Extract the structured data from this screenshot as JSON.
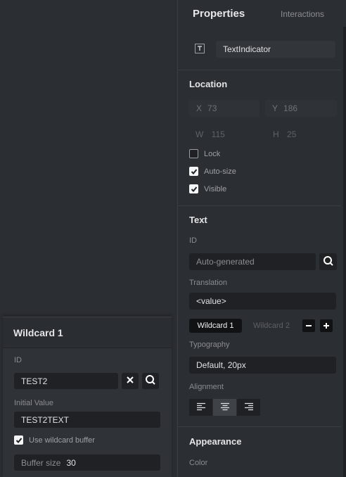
{
  "wildcard_panel": {
    "title": "Wildcard 1",
    "id_label": "ID",
    "id_value": "TEST2",
    "initial_value_label": "Initial Value",
    "initial_value": "TEST2TEXT",
    "use_buffer_label": "Use wildcard buffer",
    "use_buffer_checked": true,
    "buffer_size_label": "Buffer size",
    "buffer_size_value": "30",
    "icons": [
      "close-icon",
      "search-icon"
    ]
  },
  "properties": {
    "tabs": {
      "active": "Properties",
      "inactive": "Interactions"
    },
    "widget": {
      "icon": "text-widget-icon",
      "name": "TextIndicator"
    },
    "location": {
      "title": "Location",
      "x_label": "X",
      "x_value": "73",
      "y_label": "Y",
      "y_value": "186",
      "w_label": "W",
      "w_value": "115",
      "h_label": "H",
      "h_value": "25",
      "lock_label": "Lock",
      "lock_checked": false,
      "autosize_label": "Auto-size",
      "autosize_checked": true,
      "visible_label": "Visible",
      "visible_checked": true
    },
    "text": {
      "title": "Text",
      "id_label": "ID",
      "id_placeholder": "Auto-generated",
      "translation_label": "Translation",
      "translation_value": "<value>",
      "wildcard_tabs": [
        "Wildcard 1",
        "Wildcard 2"
      ],
      "typography_label": "Typography",
      "typography_value": "Default, 20px",
      "alignment_label": "Alignment",
      "alignment_options": [
        "align-left-icon",
        "align-center-icon",
        "align-right-icon"
      ],
      "alignment_selected": "align-center-icon"
    },
    "appearance": {
      "title": "Appearance",
      "color_label": "Color"
    }
  },
  "colors": {
    "background": "#2b2e32",
    "field": "#1f2124",
    "active_pill": "#111214",
    "text_primary": "#e3e5e7",
    "text_secondary": "#8a8d91"
  }
}
